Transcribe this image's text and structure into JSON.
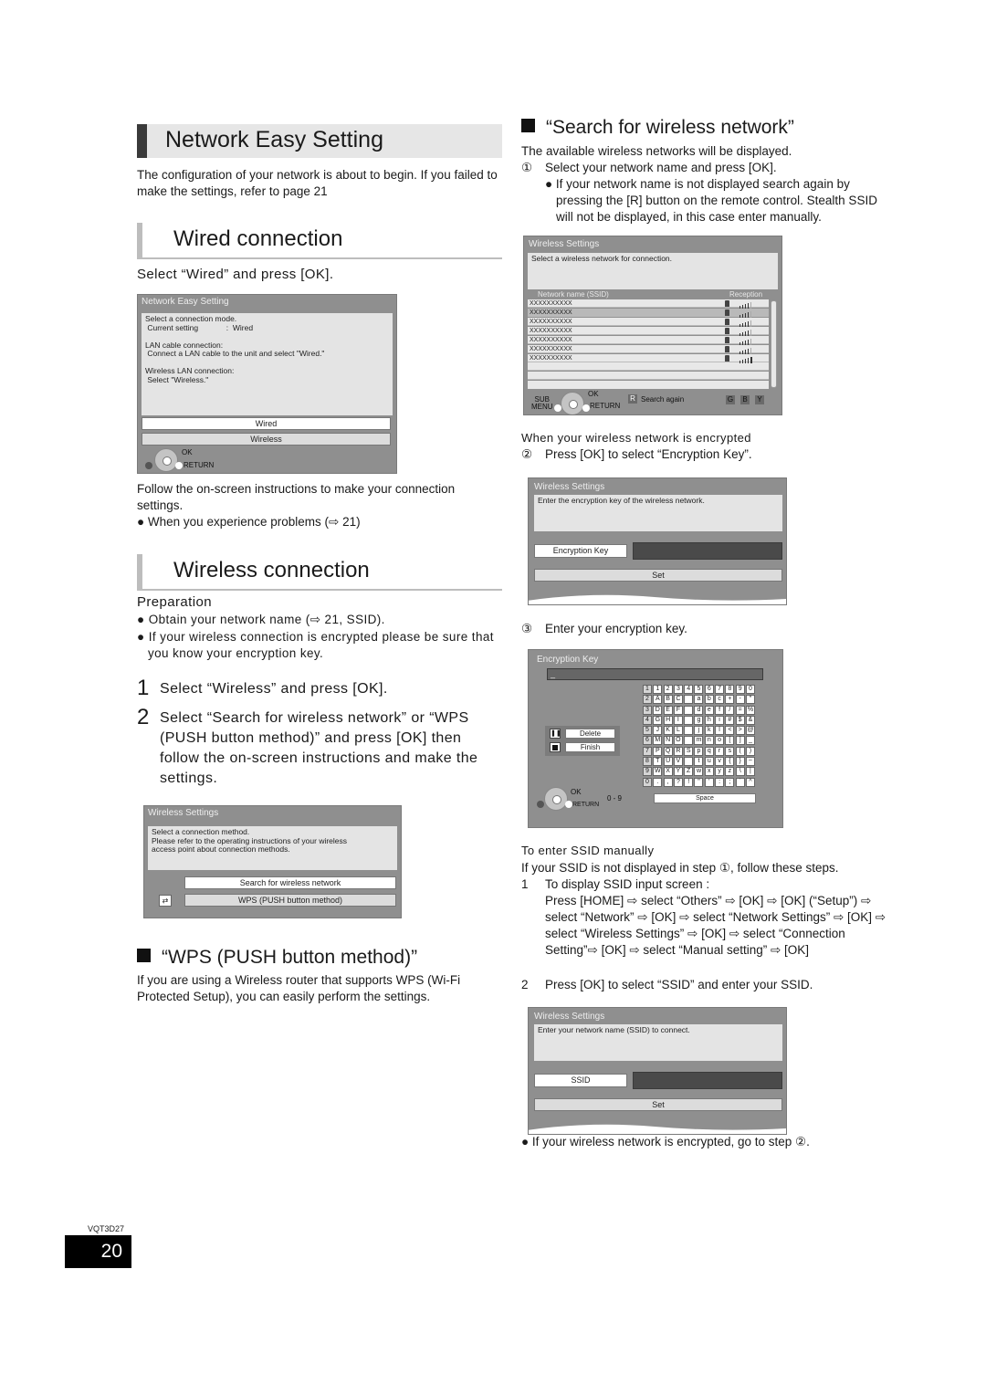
{
  "left": {
    "main_heading": "Network Easy Setting",
    "intro": "The configuration of your network is about to begin. If you failed to make the settings, refer to page 21",
    "wired": {
      "heading": "Wired connection",
      "instruction": "Select “Wired” and press [OK].",
      "dialog": {
        "title": "Network Easy Setting",
        "message": "Select a connection mode.\n Current setting             :  Wired\n\nLAN cable connection:\n Connect a LAN cable to the unit and select \"Wired.\"\n\nWireless LAN connection:\n Select \"Wireless.\"",
        "options": [
          "Wired",
          "Wireless"
        ],
        "ok_label": "OK",
        "return_label": "RETURN"
      },
      "follow_text": "Follow the on-screen instructions to make your connection settings.",
      "bullet": "When you experience problems (⇨ 21)"
    },
    "wireless": {
      "heading": "Wireless connection",
      "prep_label": "Preparation",
      "prep_bullets": [
        "Obtain your network name (⇨ 21, SSID).",
        "If your wireless connection is encrypted please be sure that you know your encryption key."
      ],
      "steps": [
        {
          "num": "1",
          "text": "Select “Wireless” and press [OK]."
        },
        {
          "num": "2",
          "text": "Select “Search for wireless network” or “WPS (PUSH button method)” and press [OK] then follow the on-screen instructions and make the settings."
        }
      ],
      "dialog": {
        "title": "Wireless Settings",
        "message": "Select a connection method.\nPlease refer to the operating instructions of your wireless\naccess point about connection methods.",
        "options": [
          "Search for wireless network",
          "WPS (PUSH button method)"
        ]
      }
    },
    "wps": {
      "heading": "“WPS (PUSH button method)”",
      "text": "If you are using a Wireless router that supports WPS (Wi-Fi Protected Setup), you can easily perform the settings."
    },
    "model_code": "VQT3D27",
    "page_number": "20"
  },
  "right": {
    "search_heading": "“Search for wireless network”",
    "search_intro": "The available wireless networks will be displayed.",
    "step1_marker": "①",
    "step1": "Select your network name and press [OK].",
    "step1_bullet": "If your network name is not displayed search again by pressing the [R] button on the remote control. Stealth SSID will not be displayed, in this case enter manually.",
    "network_dialog": {
      "title": "Wireless Settings",
      "message": "Select a wireless network for connection.",
      "col_ssid": "Network name (SSID)",
      "col_reception": "Reception",
      "networks": [
        {
          "ssid": "XXXXXXXXXX",
          "locked": true,
          "signal": 4,
          "selected": false
        },
        {
          "ssid": "XXXXXXXXXX",
          "locked": true,
          "signal": 4,
          "selected": true
        },
        {
          "ssid": "XXXXXXXXXX",
          "locked": true,
          "signal": 4,
          "selected": false
        },
        {
          "ssid": "XXXXXXXXXX",
          "locked": true,
          "signal": 4,
          "selected": false
        },
        {
          "ssid": "XXXXXXXXXX",
          "locked": true,
          "signal": 4,
          "selected": false
        },
        {
          "ssid": "XXXXXXXXXX",
          "locked": true,
          "signal": 4,
          "selected": false
        },
        {
          "ssid": "XXXXXXXXXX",
          "locked": true,
          "signal": 5,
          "selected": false
        }
      ],
      "sub_menu": "SUB\nMENU",
      "ok_label": "OK",
      "return_label": "RETURN",
      "r_key": "R",
      "search_again": "Search again",
      "color_keys": [
        "G",
        "B",
        "Y"
      ]
    },
    "encrypted_label": "When your wireless network is encrypted",
    "step2_marker": "②",
    "step2": "Press [OK] to select “Encryption Key”.",
    "enc_dialog": {
      "title": "Wireless Settings",
      "message": "Enter the encryption key of the wireless network.",
      "field_label": "Encryption Key",
      "set_label": "Set"
    },
    "step3_marker": "③",
    "step3": "Enter your encryption key.",
    "keyboard_dialog": {
      "title": "Encryption Key",
      "input_value": "_",
      "delete_label": "Delete",
      "finish_label": "Finish",
      "ok_label": "OK",
      "return_label": "RETURN",
      "range_label": "0 - 9",
      "space_label": "Space",
      "rows": [
        [
          "1",
          "1",
          "2",
          "3",
          "4",
          "5",
          "6",
          "7",
          "8",
          "9",
          "0"
        ],
        [
          "2",
          "A",
          "B",
          "C",
          "",
          "a",
          "b",
          "c",
          "+",
          "-",
          "\""
        ],
        [
          "3",
          "D",
          "E",
          "F",
          "",
          "d",
          "e",
          "f",
          "/",
          "=",
          "%"
        ],
        [
          "4",
          "G",
          "H",
          "I",
          "",
          "g",
          "h",
          "i",
          "#",
          "$",
          "&"
        ],
        [
          "5",
          "J",
          "K",
          "L",
          "",
          "j",
          "k",
          "l",
          "<",
          ">",
          "@"
        ],
        [
          "6",
          "M",
          "N",
          "O",
          "",
          "m",
          "n",
          "o",
          "[",
          "]",
          "_"
        ],
        [
          "7",
          "P",
          "Q",
          "R",
          "S",
          "p",
          "q",
          "r",
          "s",
          "(",
          ")"
        ],
        [
          "8",
          "T",
          "U",
          "V",
          "",
          "t",
          "u",
          "v",
          "{",
          "}",
          "~"
        ],
        [
          "9",
          "W",
          "X",
          "Y",
          "Z",
          "w",
          "x",
          "y",
          "z",
          "\\",
          "|"
        ],
        [
          "0",
          ".",
          ",",
          "?",
          "!",
          "\"",
          "'",
          ":",
          ";",
          "`",
          "^"
        ]
      ]
    },
    "manual": {
      "heading": "To enter SSID manually",
      "intro": "If your SSID is not displayed in step ①, follow these steps.",
      "steps": [
        {
          "num": "1",
          "text": "To display SSID input screen :",
          "detail": "Press [HOME] ⇨ select “Others” ⇨ [OK] ⇨ [OK] (“Setup”) ⇨ select “Network” ⇨ [OK] ⇨ select “Network Settings” ⇨ [OK] ⇨ select “Wireless Settings” ⇨ [OK] ⇨ select “Connection Setting”⇨ [OK] ⇨ select “Manual setting” ⇨ [OK]"
        },
        {
          "num": "2",
          "text": "Press [OK] to select “SSID” and enter your SSID.",
          "detail": ""
        }
      ]
    },
    "ssid_dialog": {
      "title": "Wireless Settings",
      "message": "Enter your network name (SSID) to connect.",
      "field_label": "SSID",
      "set_label": "Set"
    },
    "final_bullet": "If your wireless network is encrypted, go to step ②."
  }
}
